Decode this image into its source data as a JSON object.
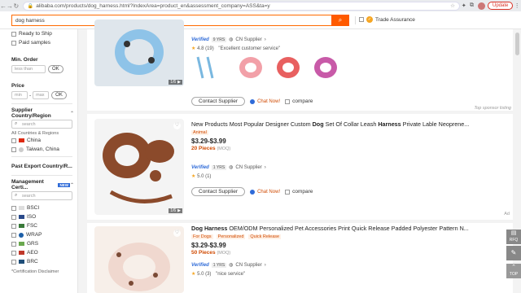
{
  "browser": {
    "url": "alibaba.com/products/dog_harness.html?IndexArea=product_en&assessment_company=ASS&ta=y",
    "update_label": "Update"
  },
  "search": {
    "value": "dog harness",
    "trade_assurance": "Trade Assurance"
  },
  "sidebar": {
    "checks": [
      "Ready to Ship",
      "Paid samples"
    ],
    "min_order": {
      "title": "Min. Order",
      "placeholder": "less than",
      "ok": "OK"
    },
    "price": {
      "title": "Price",
      "min": "min",
      "max": "max",
      "ok": "OK"
    },
    "supplier_region": {
      "title": "Supplier Country/Region",
      "search": "search",
      "all_label": "All Countries & Regions",
      "items": [
        "China",
        "Taiwan, China"
      ]
    },
    "past_export": {
      "title": "Past Export Country/R..."
    },
    "management_cert": {
      "title": "Management Certi...",
      "search": "search",
      "items": [
        "BSCI",
        "ISO",
        "FSC",
        "WRAP",
        "GRS",
        "AEO",
        "BRC"
      ],
      "disclaimer": "*Certification Disclaimer"
    }
  },
  "cards": [
    {
      "verified": "Verified",
      "years": "9 YRS",
      "region": "CN Supplier",
      "rating": "4.8",
      "reviews": "(19)",
      "review_quote": "\"Excellent customer service\"",
      "pager": "1/6",
      "contact": "Contact Supplier",
      "chat": "Chat Now!",
      "compare": "compare",
      "sponsor": "Top sponsor listing"
    },
    {
      "title_pre": "New Products Most Popular Designer Custom ",
      "title_b1": "Dog",
      "title_mid": " Set Of Collar Leash ",
      "title_b2": "Harness",
      "title_post": " Private Lable Neoprene...",
      "tags": [
        "Animal"
      ],
      "price": "$3.29-$3.99",
      "moq": "20 Pieces",
      "moq_label": "(MOQ)",
      "verified": "Verified",
      "years": "1 YRS",
      "region": "CN Supplier",
      "rating": "5.0",
      "reviews": "(1)",
      "pager": "1/6",
      "contact": "Contact Supplier",
      "chat": "Chat Now!",
      "compare": "compare",
      "ad": "Ad"
    },
    {
      "title_b1": "Dog Harness",
      "title_post": " OEM/ODM Personalized Pet Accessories Print Quick Release Padded Polyester Pattern N...",
      "tags": [
        "For Dogs",
        "Personalized",
        "Quick Release"
      ],
      "price": "$3.29-$3.99",
      "moq": "50 Pieces",
      "moq_label": "(MOQ)",
      "verified": "Verified",
      "years": "1 YRS",
      "region": "CN Supplier",
      "rating": "5.0",
      "reviews": "(3)",
      "review_quote": "\"nice service\""
    }
  ],
  "right_tools": {
    "rfq": "RFQ",
    "top": "TOP"
  },
  "colors": {
    "accent": "#ff5a00",
    "verified": "#2f6bd8",
    "moq": "#d04a02"
  }
}
